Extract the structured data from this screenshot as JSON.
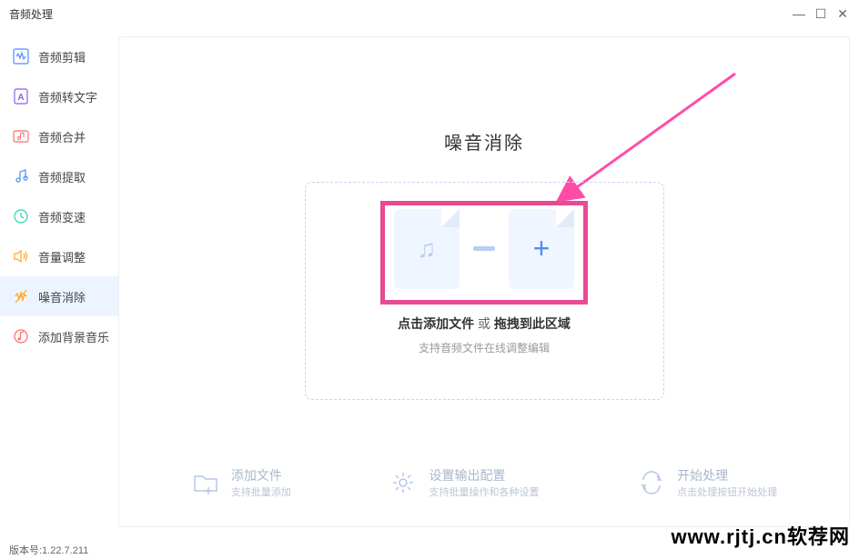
{
  "window": {
    "title": "音频处理",
    "version": "版本号:1.22.7.211"
  },
  "sidebar": {
    "items": [
      {
        "label": "音频剪辑",
        "icon": "wave"
      },
      {
        "label": "音频转文字",
        "icon": "doc-a"
      },
      {
        "label": "音频合并",
        "icon": "merge"
      },
      {
        "label": "音频提取",
        "icon": "extract"
      },
      {
        "label": "音频变速",
        "icon": "clock"
      },
      {
        "label": "音量调整",
        "icon": "volume"
      },
      {
        "label": "噪音消除",
        "icon": "mute-wave"
      },
      {
        "label": "添加背景音乐",
        "icon": "bgm"
      }
    ]
  },
  "main": {
    "title": "噪音消除",
    "drop": {
      "click_text": "点击添加文件",
      "sep": " 或 ",
      "drag_text": "拖拽到此区域",
      "subtext": "支持音频文件在线调整编辑"
    }
  },
  "actions": [
    {
      "title": "添加文件",
      "sub": "支持批量添加"
    },
    {
      "title": "设置输出配置",
      "sub": "支持批量操作和各种设置"
    },
    {
      "title": "开始处理",
      "sub": "点击处理按钮开始处理"
    }
  ],
  "watermark": "www.rjtj.cn软荐网"
}
